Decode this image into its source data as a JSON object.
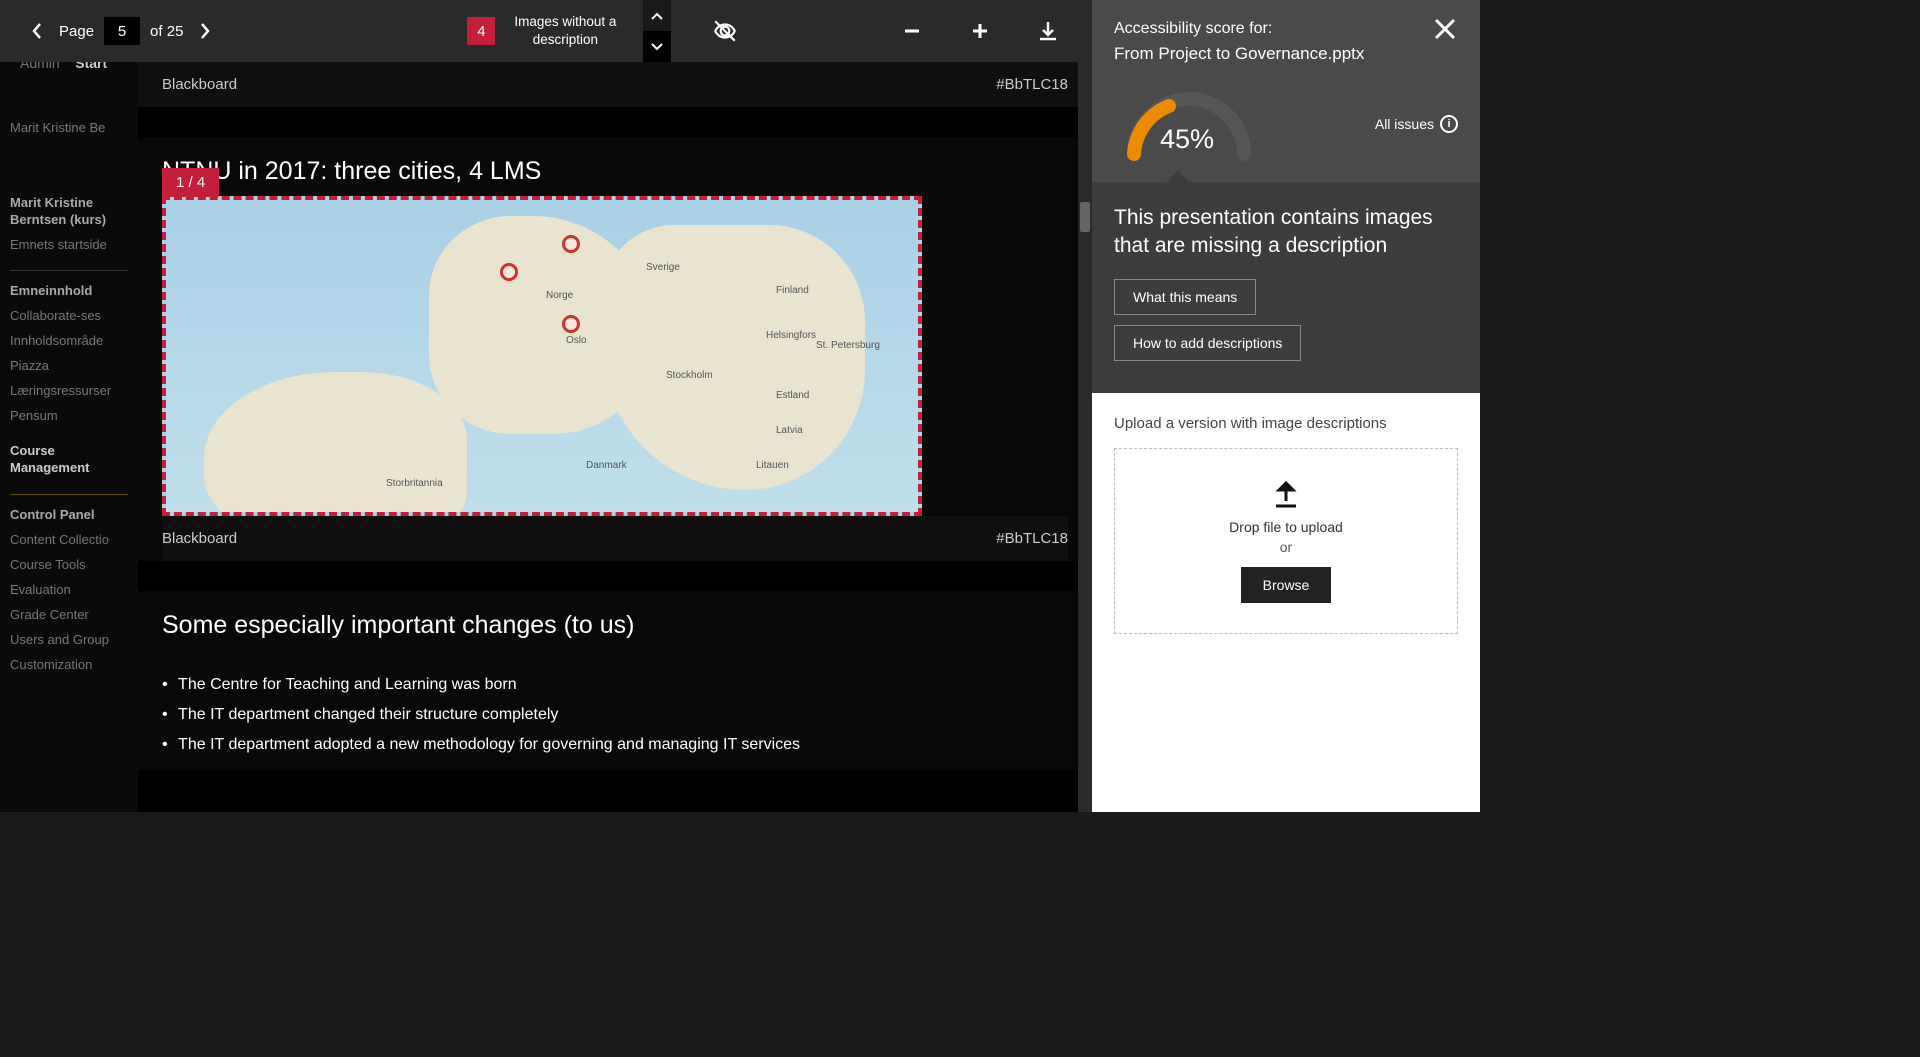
{
  "toolbar": {
    "page_label": "Page",
    "page_current": "5",
    "page_total_label": "of 25",
    "issue_count": "4",
    "issue_label": "Images without a description"
  },
  "bg": {
    "tab_admin": "Admin",
    "tab_start": "Start",
    "user": "Marit Kristine Be",
    "nav_user_title": "Marit Kristine Berntsen (kurs)",
    "nav_items_1": [
      "Emnets startside"
    ],
    "nav_title_2": "Emneinnhold",
    "nav_items_2": [
      "Collaborate-ses",
      "Innholdsområde",
      "Piazza",
      "Læringsressurser",
      "Pensum"
    ],
    "nav_title_3": "Course Management",
    "nav_title_4": "Control Panel",
    "nav_items_4": [
      "Content Collectio",
      "Course Tools",
      "Evaluation",
      "Grade Center",
      "Users and Group",
      "Customization"
    ]
  },
  "slide_prev": {
    "footer_left": "Blackboard",
    "footer_right": "#BbTLC18"
  },
  "slide5": {
    "title": "NTNU in 2017: three cities, 4 LMS",
    "image_counter": "1 / 4",
    "footer_left": "Blackboard",
    "footer_right": "#BbTLC18",
    "map_labels": {
      "norge": "Norge",
      "sverige": "Sverige",
      "finland": "Finland",
      "danmark": "Danmark",
      "storbritannia": "Storbritannia",
      "estland": "Estland",
      "latvia": "Latvia",
      "litauen": "Litauen",
      "oslo": "Oslo",
      "stockholm": "Stockholm",
      "helsinki": "Helsingfors",
      "stpetersburg": "St. Petersburg"
    }
  },
  "slide6": {
    "title": "Some especially important changes (to us)",
    "bullets": [
      "The Centre for Teaching and Learning was born",
      "The IT department changed their structure completely",
      "The IT department adopted a new methodology for governing and managing IT services"
    ]
  },
  "a11y": {
    "score_for": "Accessibility score for:",
    "filename": "From Project to Governance.pptx",
    "percent": "45%",
    "all_issues": "All issues",
    "issue_headline": "This presentation contains images that are missing a description",
    "btn_meaning": "What this means",
    "btn_howto": "How to add descriptions",
    "upload_label": "Upload a version with image descriptions",
    "drop_text": "Drop file to upload",
    "drop_or": "or",
    "browse": "Browse"
  }
}
